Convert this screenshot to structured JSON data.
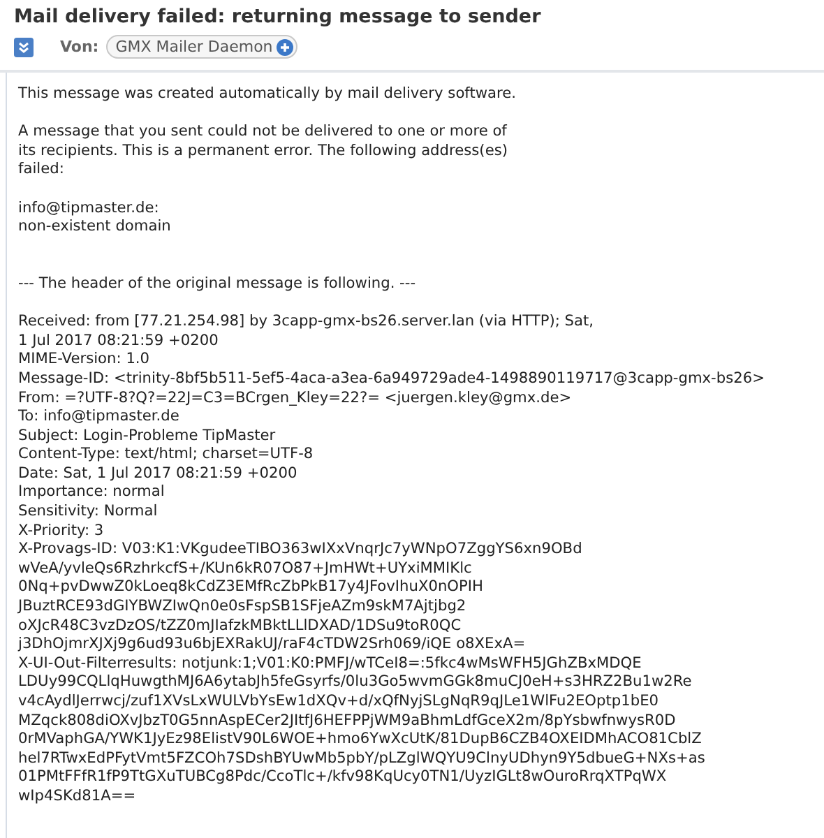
{
  "subject": "Mail delivery failed: returning message to sender",
  "from": {
    "label": "Von:",
    "sender": "GMX Mailer Daemon"
  },
  "body": [
    "This message was created automatically by mail delivery software.",
    "A message that you sent could not be delivered to one or more of\nits recipients. This is a permanent error. The following address(es)\nfailed:",
    "info@tipmaster.de:\nnon-existent domain",
    "--- The header of the original message is following. ---",
    "Received: from [77.21.254.98] by 3capp-gmx-bs26.server.lan (via HTTP); Sat,\n1 Jul 2017 08:21:59 +0200\nMIME-Version: 1.0\nMessage-ID: <trinity-8bf5b511-5ef5-4aca-a3ea-6a949729ade4-1498890119717@3capp-gmx-bs26>\nFrom: =?UTF-8?Q?=22J=C3=BCrgen_Kley=22?= <juergen.kley@gmx.de>\nTo: info@tipmaster.de\nSubject: Login-Probleme TipMaster\nContent-Type: text/html; charset=UTF-8\nDate: Sat, 1 Jul 2017 08:21:59 +0200\nImportance: normal\nSensitivity: Normal\nX-Priority: 3\nX-Provags-ID: V03:K1:VKgudeeTIBO363wIXxVnqrJc7yWNpO7ZggYS6xn9OBd\nwVeA/yvleQs6RzhrkcfS+/KUn6kR07O87+JmHWt+UYxiMMIKlc\n0Nq+pvDwwZ0kLoeq8kCdZ3EMfRcZbPkB17y4JFovIhuX0nOPIH\nJBuztRCE93dGIYBWZIwQn0e0sFspSB1SFjeAZm9skM7Ajtjbg2\noXJcR48C3vzDzOS/tZZ0mJIafzkMBktLLlDXAD/1DSu9toR0QC\nj3DhOjmrXJXj9g6ud93u6bjEXRakUJ/raF4cTDW2Srh069/iQE o8XExA=\nX-UI-Out-Filterresults: notjunk:1;V01:K0:PMFJ/wTCeI8=:5fkc4wMsWFH5JGhZBxMDQE\nLDUy99CQLlqHuwgthMJ6A6ytabJh5feGsyrfs/0lu3Go5wvmGGk8muCJ0eH+s3HRZ2Bu1w2Re\nv4cAydlJerrwcj/zuf1XVsLxWULVbYsEw1dXQv+d/xQfNyjSLgNqR9qJLe1WlFu2EOptp1bE0\nMZqck808diOXvJbzT0G5nnAspECer2JItfJ6HEFPPjWM9aBhmLdfGceX2m/8pYsbwfnwysR0D\n0rMVaphGA/YWK1JyEz98ElistV90L6WOE+hmo6YwXcUtK/81DupB6CZB4OXEIDMhACO81CblZ\nhel7RTwxEdPFytVmt5FZCOh7SDshBYUwMb5pbY/pLZglWQYU9ClnyUDhyn9Y5dbueG+NXs+as\n01PMtFFfR1fP9TtGXuTUBCg8Pdc/CcoTlc+/kfv98KqUcy0TN1/UyzIGLt8wOuroRrqXTPqWX\nwIp4SKd81A=="
  ]
}
